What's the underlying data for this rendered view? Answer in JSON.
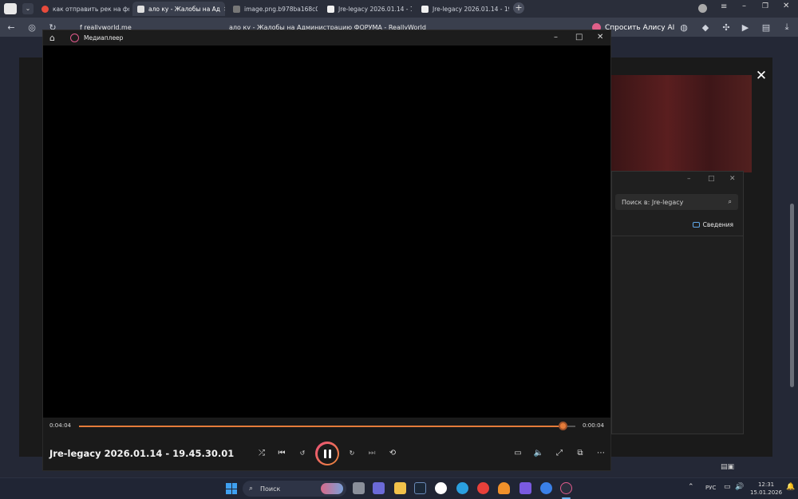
{
  "browser": {
    "tabs": [
      {
        "title": "как отправить рек на фо",
        "favicon_color": "#e84b3c"
      },
      {
        "title": "ало ку - Жалобы на Ад",
        "favicon_color": "#e0e0e0",
        "active": true
      },
      {
        "title": "image.png.b978ba168c049",
        "favicon_color": "#888"
      },
      {
        "title": "Jre-legacy 2026.01.14 - 19",
        "favicon_color": "#f0f0f0"
      },
      {
        "title": "Jre-legacy 2026.01.14 - 19",
        "favicon_color": "#f0f0f0"
      }
    ],
    "address": "f  reallyworld.me",
    "page_title": "ало ку - Жалобы на Администрацию ФОРУМА - ReallyWorld",
    "alice_label": "Спросить Алису AI"
  },
  "explorer": {
    "search_placeholder": "Поиск в: Jre-legacy",
    "info_label": "Сведения"
  },
  "player": {
    "app_name": "Медиаплеер",
    "current_time": "0:04:04",
    "total_time": "0:00:04",
    "progress": 0.975,
    "video_title": "Jre-legacy 2026.01.14 - 19.45.30.01",
    "accent": "#e57c3a"
  },
  "taskbar": {
    "search_label": "Поиск",
    "lang": "РУС",
    "time": "12:31",
    "date": "15.01.2026"
  }
}
